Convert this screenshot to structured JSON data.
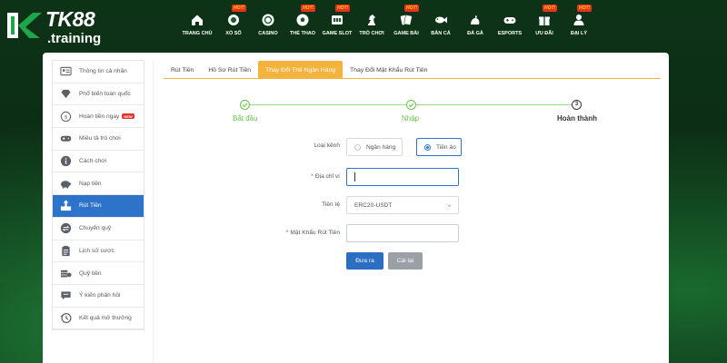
{
  "brand": {
    "name": "TK88",
    "sub": ".training",
    "accent": "#1fa64a"
  },
  "nav": {
    "hot_label": "HOT!",
    "items": [
      {
        "label": "TRANG CHỦ",
        "icon": "home-icon",
        "hot": false
      },
      {
        "label": "XỔ SỐ",
        "icon": "lottery-icon",
        "hot": true
      },
      {
        "label": "CASINO",
        "icon": "casino-chip-icon",
        "hot": false
      },
      {
        "label": "THỂ THAO",
        "icon": "soccer-ball-icon",
        "hot": true
      },
      {
        "label": "GAME SLOT",
        "icon": "slot-machine-icon",
        "hot": true
      },
      {
        "label": "TRÒ CHƠI",
        "icon": "chess-knight-icon",
        "hot": false
      },
      {
        "label": "GAME BÀI",
        "icon": "cards-icon",
        "hot": true
      },
      {
        "label": "BẮN CÁ",
        "icon": "fish-icon",
        "hot": false
      },
      {
        "label": "ĐÁ GÀ",
        "icon": "rooster-icon",
        "hot": false
      },
      {
        "label": "ESPORTS",
        "icon": "gamepad-icon",
        "hot": false
      },
      {
        "label": "ƯU ĐÃI",
        "icon": "gift-icon",
        "hot": true
      },
      {
        "label": "ĐẠI LÝ",
        "icon": "agent-icon",
        "hot": true
      }
    ]
  },
  "sidebar": {
    "items": [
      {
        "label": "Thông tin cá nhân",
        "icon": "profile-card-icon"
      },
      {
        "label": "Phổ biến toàn quốc",
        "icon": "diamond-icon"
      },
      {
        "label": "Hoàn tiền ngay",
        "icon": "refund-icon",
        "badge": "NEW"
      },
      {
        "label": "Miêu tả trò chơi",
        "icon": "gamepad-icon"
      },
      {
        "label": "Cách chơi",
        "icon": "info-icon"
      },
      {
        "label": "Nạp tiền",
        "icon": "piggy-bank-icon"
      },
      {
        "label": "Rút Tiền",
        "icon": "withdraw-icon",
        "active": true
      },
      {
        "label": "Chuyển quỹ",
        "icon": "transfer-icon"
      },
      {
        "label": "Lịch sử cược",
        "icon": "clipboard-icon"
      },
      {
        "label": "Quỹ tiền",
        "icon": "money-stack-icon"
      },
      {
        "label": "Ý kiến phản hồi",
        "icon": "feedback-icon"
      },
      {
        "label": "Kết quả mở thưởng",
        "icon": "history-icon"
      }
    ]
  },
  "tabs": [
    {
      "label": "Rút Tiền",
      "active": false
    },
    {
      "label": "Hồ Sơ Rút Tiền",
      "active": false
    },
    {
      "label": "Thay Đổi Thẻ Ngân Hàng",
      "active": true
    },
    {
      "label": "Thay Đổi Mật Khẩu Rút Tiền",
      "active": false
    }
  ],
  "stepper": {
    "steps": [
      {
        "label": "Bắt đầu",
        "state": "done"
      },
      {
        "label": "Nhập",
        "state": "done"
      },
      {
        "label": "Hoàn thành",
        "state": "current",
        "number": "3"
      }
    ]
  },
  "form": {
    "channel_label": "Loại kênh",
    "channel_options": [
      {
        "label": "Ngân hàng",
        "selected": false
      },
      {
        "label": "Tiền ảo",
        "selected": true
      }
    ],
    "wallet_label": "Địa chỉ ví",
    "wallet_value": "",
    "currency_label": "Tiền tệ",
    "currency_value": "ERC20-USDT",
    "password_label": "Mật Khẩu Rút Tiền",
    "password_value": "",
    "submit_label": "Đưa ra",
    "reset_label": "Cài lại"
  }
}
